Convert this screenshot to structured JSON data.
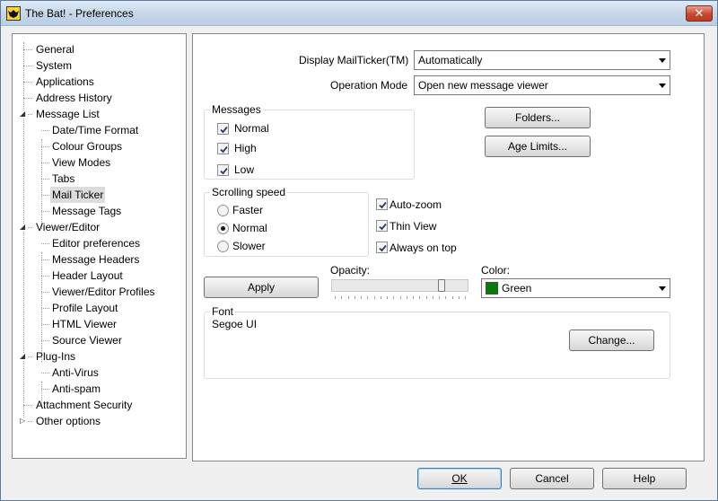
{
  "window": {
    "title": "The Bat! - Preferences",
    "close_glyph": "✕"
  },
  "tree": {
    "items": [
      {
        "label": "General",
        "level": 0
      },
      {
        "label": "System",
        "level": 0
      },
      {
        "label": "Applications",
        "level": 0
      },
      {
        "label": "Address History",
        "level": 0
      },
      {
        "label": "Message List",
        "level": 0,
        "expanded": true
      },
      {
        "label": "Date/Time Format",
        "level": 1
      },
      {
        "label": "Colour Groups",
        "level": 1
      },
      {
        "label": "View Modes",
        "level": 1
      },
      {
        "label": "Tabs",
        "level": 1
      },
      {
        "label": "Mail Ticker",
        "level": 1,
        "selected": true
      },
      {
        "label": "Message Tags",
        "level": 1
      },
      {
        "label": "Viewer/Editor",
        "level": 0,
        "expanded": true
      },
      {
        "label": "Editor preferences",
        "level": 1
      },
      {
        "label": "Message Headers",
        "level": 1
      },
      {
        "label": "Header Layout",
        "level": 1
      },
      {
        "label": "Viewer/Editor Profiles",
        "level": 1
      },
      {
        "label": "Profile Layout",
        "level": 1
      },
      {
        "label": "HTML Viewer",
        "level": 1
      },
      {
        "label": "Source Viewer",
        "level": 1
      },
      {
        "label": "Plug-Ins",
        "level": 0,
        "expanded": true
      },
      {
        "label": "Anti-Virus",
        "level": 1
      },
      {
        "label": "Anti-spam",
        "level": 1
      },
      {
        "label": "Attachment Security",
        "level": 0
      },
      {
        "label": "Other options",
        "level": 0,
        "collapsed": true
      }
    ]
  },
  "mailticker": {
    "display_label": "Display MailTicker(TM)",
    "display_value": "Automatically",
    "operation_label": "Operation Mode",
    "operation_value": "Open new message viewer",
    "messages": {
      "title": "Messages",
      "normal": {
        "label": "Normal",
        "checked": true
      },
      "high": {
        "label": "High",
        "checked": true
      },
      "low": {
        "label": "Low",
        "checked": true
      }
    },
    "folders_button": "Folders...",
    "age_limits_button": "Age Limits...",
    "scrolling": {
      "title": "Scrolling speed",
      "faster": "Faster",
      "normal": "Normal",
      "slower": "Slower",
      "selected": "Normal"
    },
    "auto_zoom": {
      "label": "Auto-zoom",
      "checked": true
    },
    "thin_view": {
      "label": "Thin View",
      "checked": true
    },
    "always_on_top": {
      "label": "Always on top",
      "checked": true
    },
    "apply_button": "Apply",
    "opacity_label": "Opacity:",
    "opacity_value": 0.82,
    "color_label": "Color:",
    "color_value": "Green",
    "color_hex": "#0a7a0a",
    "font": {
      "title": "Font",
      "value": "Segoe UI",
      "change_button": "Change..."
    }
  },
  "footer": {
    "ok_button": "OK",
    "cancel_button": "Cancel",
    "help_button": "Help"
  }
}
